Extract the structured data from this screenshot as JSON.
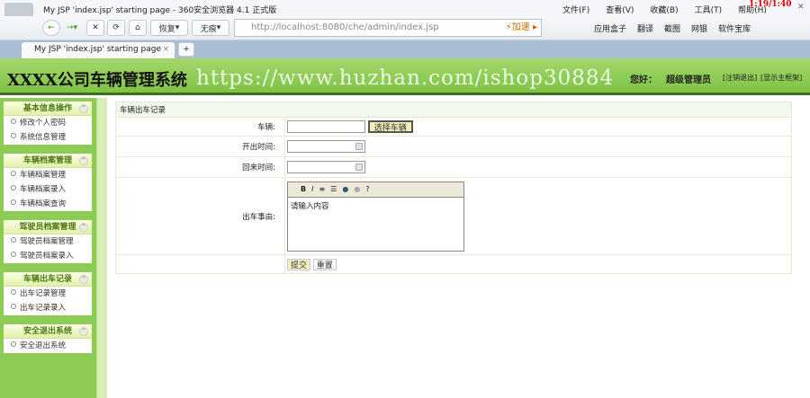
{
  "browser": {
    "window_title": "My JSP 'index.jsp' starting page - 360安全浏览器 4.1 正式版",
    "menu": [
      "文件(F)",
      "查看(V)",
      "收藏(B)",
      "工具(T)",
      "帮助(H)"
    ],
    "clock": "1:19/1:40",
    "restore": "恢复",
    "incognito": "无痕",
    "url": "http://localhost:8080/che/admin/index.jsp",
    "accelerate": "加速",
    "tools": [
      "应用盒子",
      "翻译",
      "截图",
      "网银",
      "软件宝库"
    ],
    "tab_title": "My JSP 'index.jsp' starting page"
  },
  "header": {
    "title": "XXXX公司车辆管理系统",
    "watermark": "https://www.huzhan.com/ishop30884",
    "greeting": "您好：",
    "user": "超级管理员",
    "logout": "[注销退出]",
    "show_frame": "[显示主框架]"
  },
  "sidebar": [
    {
      "title": "基本信息操作",
      "items": [
        "修改个人密码",
        "系统信息管理"
      ]
    },
    {
      "title": "车辆档案管理",
      "items": [
        "车辆档案管理",
        "车辆档案录入",
        "车辆档案查询"
      ]
    },
    {
      "title": "驾驶员档案管理",
      "items": [
        "驾驶员档案管理",
        "驾驶员档案录入"
      ]
    },
    {
      "title": "车辆出车记录",
      "items": [
        "出车记录管理",
        "出车记录录入"
      ]
    },
    {
      "title": "安全退出系统",
      "items": [
        "安全退出系统"
      ]
    }
  ],
  "form": {
    "title": "车辆出车记录",
    "vehicle_label": "车辆:",
    "select_vehicle": "选择车辆",
    "depart_label": "开出时间:",
    "return_label": "回来时间:",
    "reason_label": "出车事由:",
    "reason_placeholder": "请输入内容",
    "submit": "提交",
    "reset": "重置"
  }
}
